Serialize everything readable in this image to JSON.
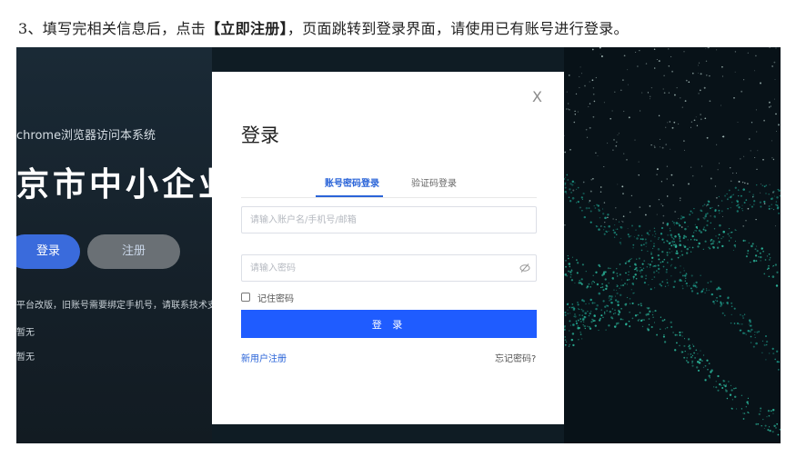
{
  "instruction": {
    "prefix": "3、填写完相关信息后，点击",
    "highlight": "【立即注册】",
    "suffix": "，页面跳转到登录界面，请使用已有账号进行登录。"
  },
  "background": {
    "browser_hint": "chrome浏览器访问本系统",
    "system_title": "京市中小企业",
    "login_button": "登录",
    "register_button": "注册",
    "notice": "平台改版，旧账号需要绑定手机号，请联系技术支持协",
    "placeholder_1": "暂无",
    "placeholder_2": "暂无"
  },
  "modal": {
    "close": "X",
    "title": "登录",
    "tabs": [
      {
        "label": "账号密码登录",
        "active": true
      },
      {
        "label": "验证码登录",
        "active": false
      }
    ],
    "account_placeholder": "请输入账户名/手机号/邮箱",
    "password_placeholder": "请输入密码",
    "remember_label": "记住密码",
    "remember_checked": false,
    "login_button": "登 录",
    "register_link": "新用户注册",
    "forgot_link": "忘记密码?",
    "accent_color": "#1f5cff"
  }
}
